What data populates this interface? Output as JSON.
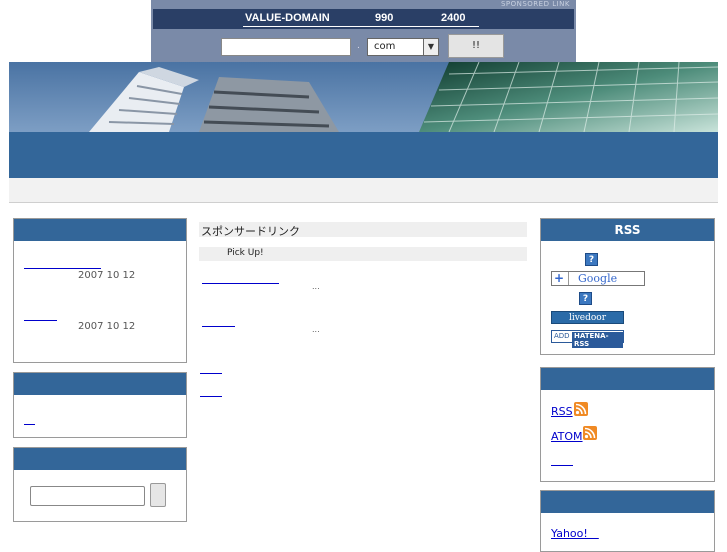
{
  "adbar": {
    "sponsor": "SPONSORED LINK",
    "brand": "VALUE-DOMAIN",
    "price1": "990",
    "price2": "2400",
    "domain_input": "",
    "dot": ".",
    "tld": "com",
    "go_label": "!!"
  },
  "left": {
    "box1": {
      "posts": [
        {
          "link": "　　　　　　　",
          "date": "2007 10 12"
        },
        {
          "link": "　　　",
          "date": "2007 10 12"
        }
      ]
    },
    "box2": {
      "link": "　"
    },
    "box3": {
      "search_value": ""
    }
  },
  "center": {
    "sponsor": "スポンサードリンク",
    "pickup": "Pick Up!",
    "items": [
      {
        "link": "　　　　　　　",
        "excerpt": "..."
      },
      {
        "link": "　　　",
        "excerpt": "..."
      }
    ],
    "links": [
      "　　",
      "　　"
    ]
  },
  "right": {
    "rss_title": "RSS",
    "help1": "?",
    "google_plus": "+",
    "google_label": "Google",
    "help2": "?",
    "livedoor": "livedoor Reader",
    "hatena_add": "ADD",
    "hatena_label": "HATENA-RSS",
    "feeds": {
      "rss": "RSS",
      "atom": "ATOM",
      "third": "　　"
    },
    "yahoo": "Yahoo!　"
  }
}
